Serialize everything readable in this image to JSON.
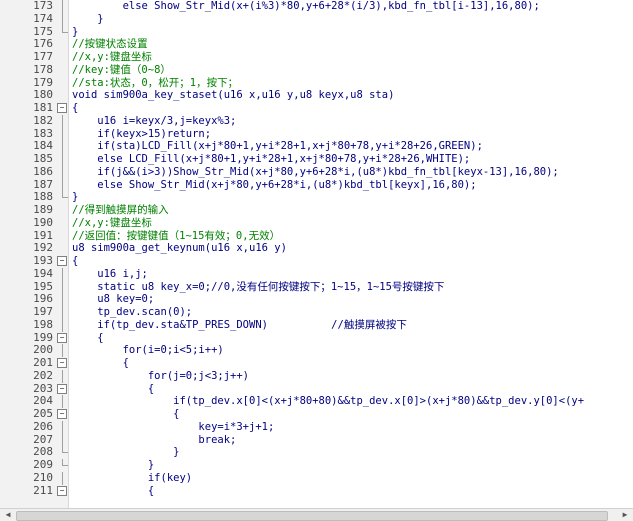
{
  "editor": {
    "lines": [
      {
        "num": "173",
        "text": "        else Show_Str_Mid(x+(i%3)*80,y+6+28*(i/3),kbd_fn_tbl[i-13],16,80);",
        "kind": "code",
        "fold": "vline"
      },
      {
        "num": "174",
        "text": "    }",
        "kind": "code",
        "fold": "vline"
      },
      {
        "num": "175",
        "text": "}",
        "kind": "code",
        "fold": "endl"
      },
      {
        "num": "176",
        "text": "//按键状态设置",
        "kind": "comment",
        "fold": ""
      },
      {
        "num": "177",
        "text": "//x,y:键盘坐标",
        "kind": "comment",
        "fold": ""
      },
      {
        "num": "178",
        "text": "//key:键值（0~8）",
        "kind": "comment",
        "fold": ""
      },
      {
        "num": "179",
        "text": "//sta:状态，0，松开；1，按下；",
        "kind": "comment",
        "fold": ""
      },
      {
        "num": "180",
        "text": "void sim900a_key_staset(u16 x,u16 y,u8 keyx,u8 sta)",
        "kind": "code",
        "fold": ""
      },
      {
        "num": "181",
        "text": "{",
        "kind": "code",
        "fold": "start"
      },
      {
        "num": "182",
        "text": "    u16 i=keyx/3,j=keyx%3;",
        "kind": "code",
        "fold": "vline"
      },
      {
        "num": "183",
        "text": "    if(keyx>15)return;",
        "kind": "code",
        "fold": "vline"
      },
      {
        "num": "184",
        "text": "    if(sta)LCD_Fill(x+j*80+1,y+i*28+1,x+j*80+78,y+i*28+26,GREEN);",
        "kind": "code",
        "fold": "vline"
      },
      {
        "num": "185",
        "text": "    else LCD_Fill(x+j*80+1,y+i*28+1,x+j*80+78,y+i*28+26,WHITE);",
        "kind": "code",
        "fold": "vline"
      },
      {
        "num": "186",
        "text": "    if(j&&(i>3))Show_Str_Mid(x+j*80,y+6+28*i,(u8*)kbd_fn_tbl[keyx-13],16,80);",
        "kind": "code",
        "fold": "vline"
      },
      {
        "num": "187",
        "text": "    else Show_Str_Mid(x+j*80,y+6+28*i,(u8*)kbd_tbl[keyx],16,80);",
        "kind": "code",
        "fold": "vline"
      },
      {
        "num": "188",
        "text": "}",
        "kind": "code",
        "fold": "endl"
      },
      {
        "num": "189",
        "text": "//得到触摸屏的输入",
        "kind": "comment",
        "fold": ""
      },
      {
        "num": "190",
        "text": "//x,y:键盘坐标",
        "kind": "comment",
        "fold": ""
      },
      {
        "num": "191",
        "text": "//返回值：按键键值（1~15有效；0,无效）",
        "kind": "comment",
        "fold": ""
      },
      {
        "num": "192",
        "text": "u8 sim900a_get_keynum(u16 x,u16 y)",
        "kind": "code",
        "fold": ""
      },
      {
        "num": "193",
        "text": "{",
        "kind": "code",
        "fold": "start"
      },
      {
        "num": "194",
        "text": "    u16 i,j;",
        "kind": "code",
        "fold": "vline"
      },
      {
        "num": "195",
        "text": "    static u8 key_x=0;//0,没有任何按键按下；1~15，1~15号按键按下",
        "kind": "code",
        "fold": "vline"
      },
      {
        "num": "196",
        "text": "    u8 key=0;",
        "kind": "code",
        "fold": "vline"
      },
      {
        "num": "197",
        "text": "    tp_dev.scan(0);",
        "kind": "code",
        "fold": "vline"
      },
      {
        "num": "198",
        "text": "    if(tp_dev.sta&TP_PRES_DOWN)          //触摸屏被按下",
        "kind": "code",
        "fold": "vline"
      },
      {
        "num": "199",
        "text": "    {",
        "kind": "code",
        "fold": "start"
      },
      {
        "num": "200",
        "text": "        for(i=0;i<5;i++)",
        "kind": "code",
        "fold": "vline"
      },
      {
        "num": "201",
        "text": "        {",
        "kind": "code",
        "fold": "start"
      },
      {
        "num": "202",
        "text": "            for(j=0;j<3;j++)",
        "kind": "code",
        "fold": "vline"
      },
      {
        "num": "203",
        "text": "            {",
        "kind": "code",
        "fold": "start"
      },
      {
        "num": "204",
        "text": "                if(tp_dev.x[0]<(x+j*80+80)&&tp_dev.x[0]>(x+j*80)&&tp_dev.y[0]<(y+",
        "kind": "code",
        "fold": "vline"
      },
      {
        "num": "205",
        "text": "                {",
        "kind": "code",
        "fold": "start"
      },
      {
        "num": "206",
        "text": "                    key=i*3+j+1;",
        "kind": "code",
        "fold": "vline"
      },
      {
        "num": "207",
        "text": "                    break;",
        "kind": "code",
        "fold": "vline"
      },
      {
        "num": "208",
        "text": "                }",
        "kind": "code",
        "fold": "endl"
      },
      {
        "num": "209",
        "text": "            }",
        "kind": "code",
        "fold": "endl"
      },
      {
        "num": "210",
        "text": "            if(key)",
        "kind": "code",
        "fold": "vline"
      },
      {
        "num": "211",
        "text": "            {",
        "kind": "code",
        "fold": "start"
      }
    ]
  },
  "scrollbar": {
    "left_arrow": "◀",
    "right_arrow": "▶"
  }
}
